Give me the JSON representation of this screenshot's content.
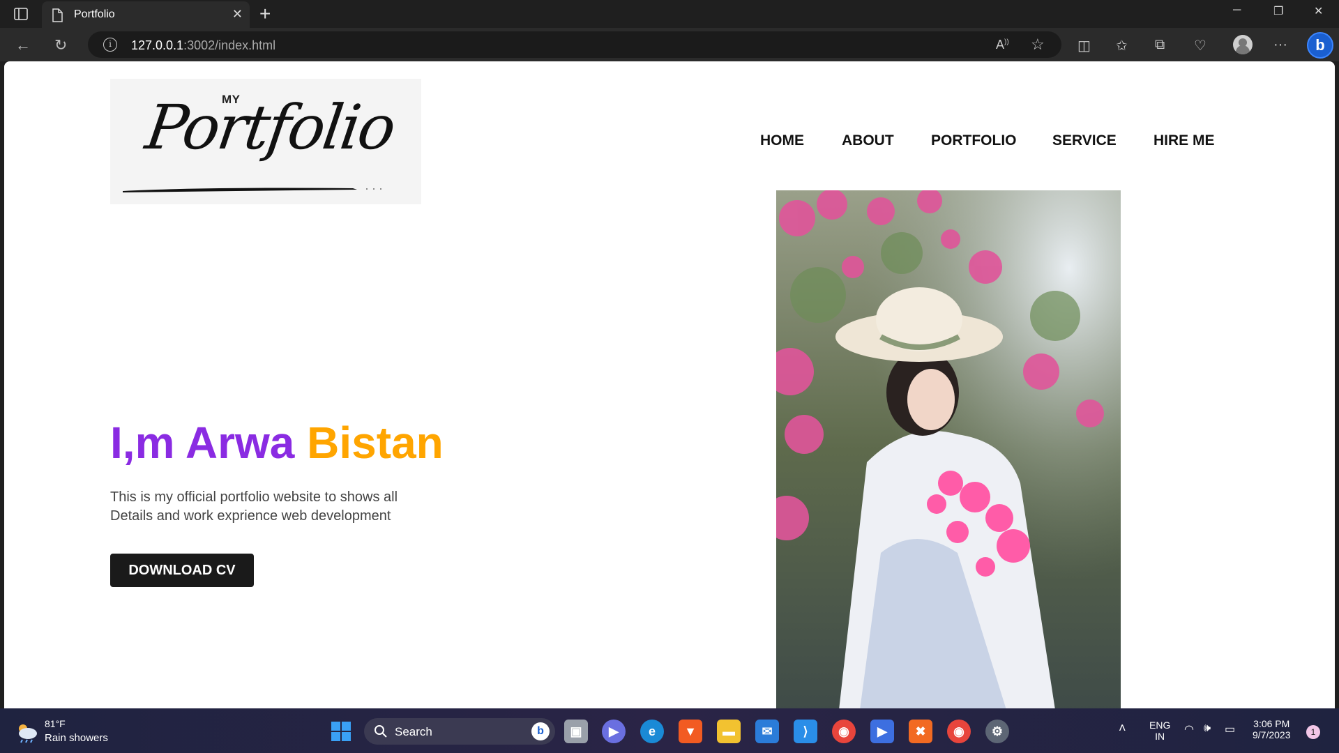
{
  "browser": {
    "tab_title": "Portfolio",
    "url_host": "127.0.0.1",
    "url_rest": ":3002/index.html"
  },
  "site": {
    "logo_small": "MY",
    "logo_script": "Portfolio",
    "nav": [
      "HOME",
      "ABOUT",
      "PORTFOLIO",
      "SERVICE",
      "HIRE ME"
    ],
    "hero_name_part1": "I,m Arwa",
    "hero_name_part2": "Bistan",
    "hero_line1": "This is my official portfolio website to shows all",
    "hero_line2": "Details and work exprience web development",
    "cv_button": "DOWNLOAD CV",
    "colors": {
      "name_purple": "#8a2be2",
      "name_orange": "#ffa500",
      "button_bg": "#1a1a1a"
    }
  },
  "taskbar": {
    "weather_temp": "81°F",
    "weather_cond": "Rain showers",
    "search_label": "Search",
    "lang_line1": "ENG",
    "lang_line2": "IN",
    "time": "3:06 PM",
    "date": "9/7/2023",
    "notification_count": "1"
  }
}
